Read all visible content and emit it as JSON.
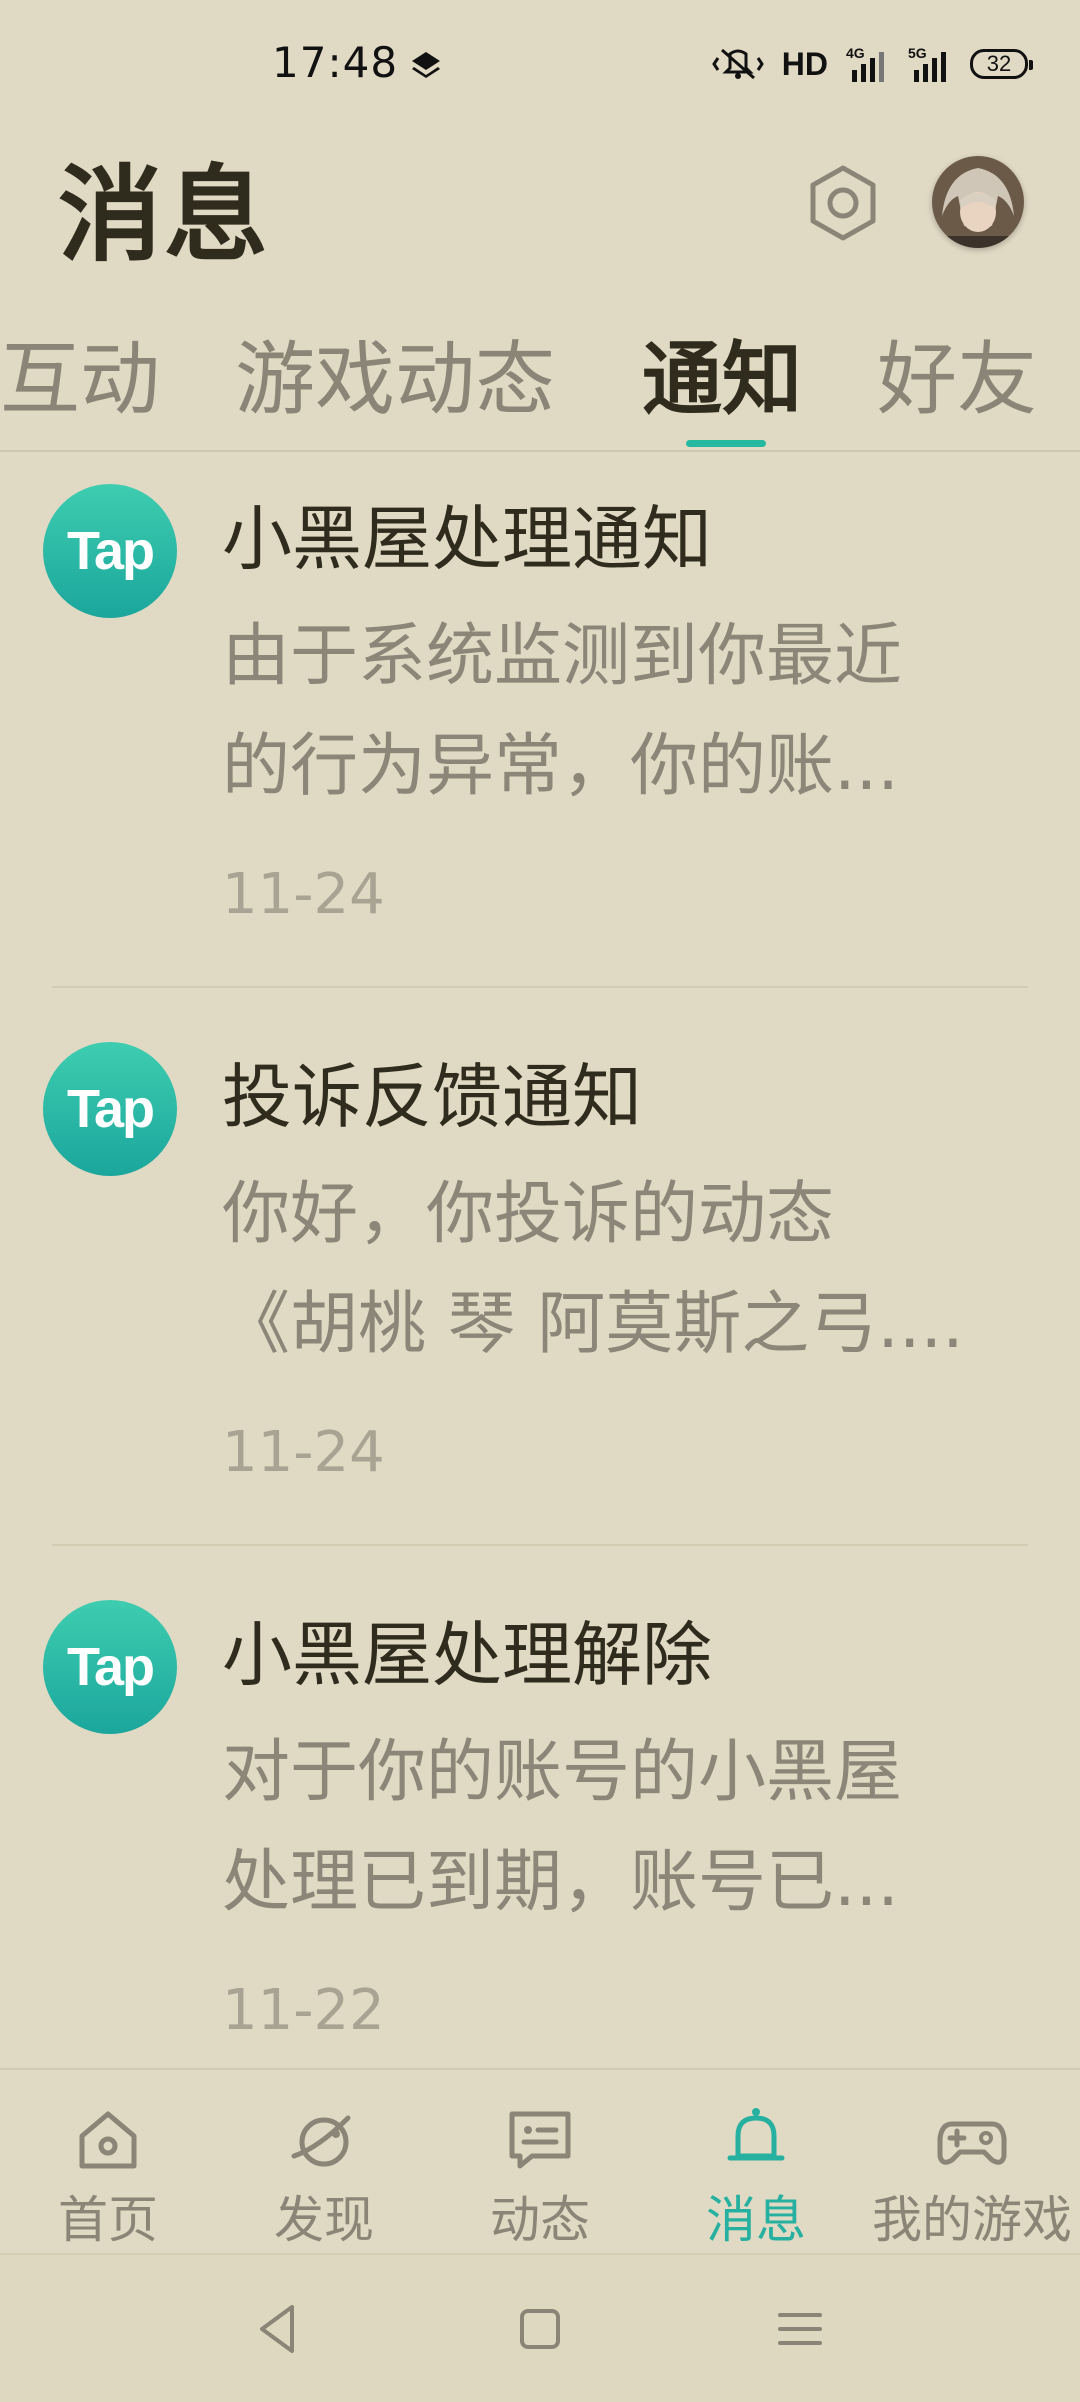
{
  "status_bar": {
    "time": "17:48",
    "network_label": "HD",
    "battery": "32",
    "icons": [
      "layers-icon",
      "vibrate-mute-icon",
      "hd-icon",
      "4g-signal-icon",
      "5g-signal-icon",
      "battery-icon"
    ]
  },
  "header": {
    "title": "消息",
    "settings_icon": "hexagon-gear-icon",
    "avatar_icon": "user-avatar"
  },
  "tabs": [
    {
      "label": "互动",
      "active": false
    },
    {
      "label": "游戏动态",
      "active": false
    },
    {
      "label": "通知",
      "active": true
    },
    {
      "label": "好友",
      "active": false
    }
  ],
  "notifications": [
    {
      "sender_logo": "Tap",
      "title": "小黑屋处理通知",
      "body_line1": "由于系统监测到你最近",
      "body_line2": "的行为异常，你的账...",
      "date": "11-24"
    },
    {
      "sender_logo": "Tap",
      "title": "投诉反馈通知",
      "body_line1": "你好，你投诉的动态",
      "body_line2": "《胡桃 琴 阿莫斯之弓....",
      "date": "11-24"
    },
    {
      "sender_logo": "Tap",
      "title": "小黑屋处理解除",
      "body_line1": "对于你的账号的小黑屋",
      "body_line2": "处理已到期，账号已...",
      "date": "11-22"
    }
  ],
  "bottom_nav": [
    {
      "label": "首页",
      "icon": "home-icon",
      "active": false
    },
    {
      "label": "发现",
      "icon": "planet-icon",
      "active": false
    },
    {
      "label": "动态",
      "icon": "chat-card-icon",
      "active": false
    },
    {
      "label": "消息",
      "icon": "bell-icon",
      "active": true
    },
    {
      "label": "我的游戏",
      "icon": "gamepad-icon",
      "active": false
    }
  ],
  "system_nav": [
    "back-icon",
    "home-square-icon",
    "menu-icon"
  ],
  "colors": {
    "background": "#e0d9c3",
    "accent": "#25b9a1",
    "title_text": "#2f2b1d",
    "secondary_text": "#8b8678"
  }
}
